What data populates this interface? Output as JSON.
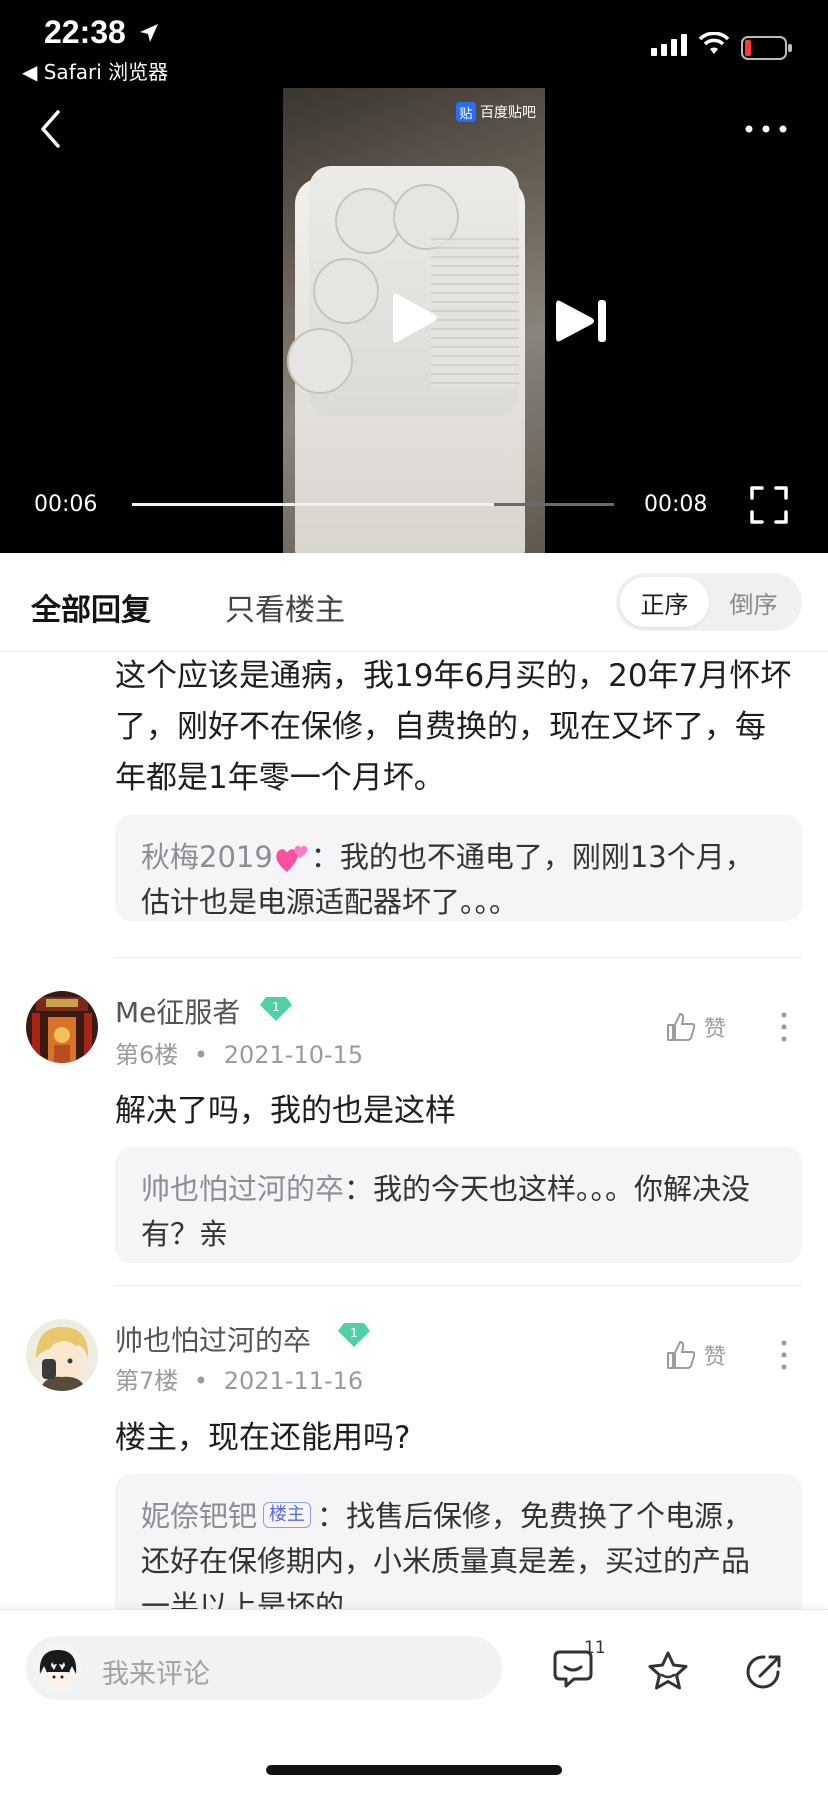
{
  "status_bar": {
    "time": "22:38",
    "back_app": "◀ Safari 浏览器"
  },
  "video": {
    "watermark": "百度贴吧",
    "watermark_icon": "贴",
    "current_time": "00:06",
    "total_time": "00:08",
    "progress_fraction": 0.75
  },
  "tabs": {
    "all": "全部回复",
    "op_only": "只看楼主",
    "sort_asc": "正序",
    "sort_desc": "倒序"
  },
  "posts": [
    {
      "text": "这个应该是通病，我19年6月买的，20年7月怀坏了，刚好不在保修，自费换的，现在又坏了，每年都是1年零一个月坏。",
      "reply": {
        "name": "秋梅2019",
        "text": "：我的也不通电了，刚刚13个月，估计也是电源适配器坏了。。。"
      }
    },
    {
      "username": "Me征服者",
      "level": "1",
      "floor": "第6楼",
      "date": "2021-10-15",
      "like_label": "赞",
      "text": "解决了吗，我的也是这样",
      "reply": {
        "name": "帅也怕过河的卒",
        "text": "：我的今天也这样。。。你解决没有？亲"
      }
    },
    {
      "username": "帅也怕过河的卒",
      "level": "1",
      "floor": "第7楼",
      "date": "2021-11-16",
      "like_label": "赞",
      "text": "楼主，现在还能用吗?",
      "reply": {
        "name": "妮倷钯钯",
        "badge": "楼主",
        "text": "：找售后保修，免费换了个电源，还好在保修期内，小米质量真是差，买过的产品一半以上是坏的"
      }
    }
  ],
  "bottom": {
    "placeholder": "我来评论",
    "reply_count": "11"
  },
  "colors": {
    "gem": "#4fd1a5",
    "op_badge": "#5b6cd8"
  }
}
